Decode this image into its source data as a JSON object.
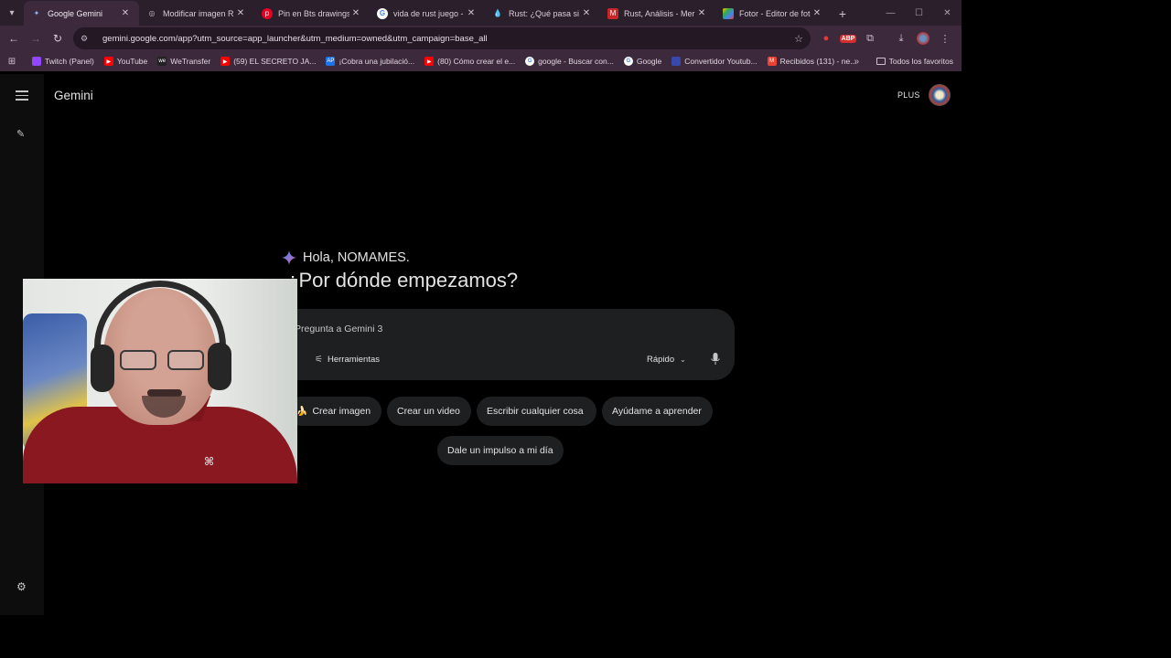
{
  "browser": {
    "tabs": [
      {
        "title": "Google Gemini",
        "favicon_color": "#8ab4f8",
        "active": true
      },
      {
        "title": "Modificar imagen Rus",
        "favicon_color": "#9e9e9e",
        "active": false
      },
      {
        "title": "Pin en Bts drawings",
        "favicon_color": "#e60023",
        "active": false
      },
      {
        "title": "vida de rust juego - B",
        "favicon_color": "#4285f4",
        "active": false
      },
      {
        "title": "Rust: ¿Qué pasa si mu",
        "favicon_color": "#64b5f6",
        "active": false
      },
      {
        "title": "Rust, Análisis - Meristation",
        "favicon_color": "#c62828",
        "active": false
      },
      {
        "title": "Fotor - Editor de foto",
        "favicon_color": "#fbbc04",
        "active": false
      }
    ],
    "new_tab_label": "+",
    "url": "gemini.google.com/app?utm_source=app_launcher&utm_medium=owned&utm_campaign=base_all",
    "bookmarks": [
      {
        "label": "Twitch (Panel)",
        "color": "#9146ff"
      },
      {
        "label": "YouTube",
        "color": "#ff0000"
      },
      {
        "label": "WeTransfer",
        "color": "#222222"
      },
      {
        "label": "(59) EL SECRETO JA...",
        "color": "#ff0000"
      },
      {
        "label": "¡Cobra una jubilació...",
        "color": "#1a73e8"
      },
      {
        "label": "(80) Cómo crear el e...",
        "color": "#ff0000"
      },
      {
        "label": "google - Buscar con...",
        "color": "#4285f4"
      },
      {
        "label": "Google",
        "color": "#4285f4"
      },
      {
        "label": "Convertidor Youtub...",
        "color": "#3949ab"
      },
      {
        "label": "Recibidos (131) - ne...",
        "color": "#ea4335"
      }
    ],
    "all_bookmarks_label": "Todos los favoritos"
  },
  "gemini": {
    "brand": "Gemini",
    "plan_badge": "PLUS",
    "greeting": "Hola, NOMAMES.",
    "headline": "¿Por dónde empezamos?",
    "prompt_placeholder": "Pregunta a Gemini 3",
    "tools_label": "Herramientas",
    "mode_label": "Rápido",
    "chips": [
      {
        "label": "Crear imagen",
        "emoji": "🍌"
      },
      {
        "label": "Crear un video"
      },
      {
        "label": "Escribir cualquier cosa"
      },
      {
        "label": "Ayúdame a aprender"
      },
      {
        "label": "Dale un impulso a mi día"
      }
    ],
    "accent_colors": {
      "sparkle_a": "#4285f4",
      "sparkle_b": "#ea4335",
      "surface": "#1e1f20"
    }
  },
  "icons": [
    "menu-icon",
    "new-chat-icon",
    "settings-icon",
    "sparkle-icon",
    "tools-icon",
    "mic-icon",
    "chevron-down-icon",
    "star-icon",
    "download-icon",
    "extensions-icon",
    "kebab-icon"
  ]
}
